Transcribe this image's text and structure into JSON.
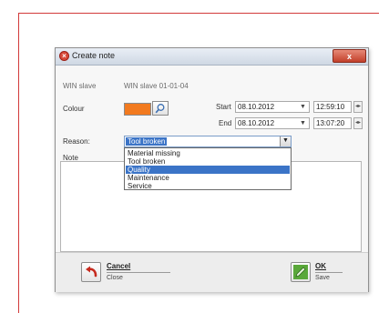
{
  "dialog": {
    "title": "Create note",
    "close_label": "x"
  },
  "fields": {
    "win_slave_label": "WIN slave",
    "win_slave_value": "WIN slave 01-01-04",
    "colour_label": "Colour",
    "colour_value": "#f27a1f",
    "start_label": "Start",
    "start_date": "08.10.2012",
    "start_time": "12:59:10",
    "end_label": "End",
    "end_date": "08.10.2012",
    "end_time": "13:07:20",
    "reason_label": "Reason:",
    "reason_selected": "Tool broken",
    "note_label": "Note"
  },
  "reason_options": [
    {
      "label": "Material missing",
      "highlighted": false
    },
    {
      "label": "Tool broken",
      "highlighted": false
    },
    {
      "label": "Quality",
      "highlighted": true
    },
    {
      "label": "Maintenance",
      "highlighted": false
    },
    {
      "label": "Service",
      "highlighted": false
    }
  ],
  "buttons": {
    "cancel_label": "Cancel",
    "cancel_sub": "Close",
    "ok_label": "OK",
    "ok_sub": "Save"
  },
  "icons": {
    "title": "close-circle-icon",
    "colour_picker": "magnifier-icon",
    "dropdown": "chevron-down-icon",
    "spin": "spin-arrows-icon",
    "cancel": "cancel-undo-icon",
    "ok": "ok-pencil-icon"
  },
  "colors": {
    "frame_accent": "#d23a3a",
    "selection": "#3b74c7",
    "colour_swatch": "#f27a1f"
  }
}
